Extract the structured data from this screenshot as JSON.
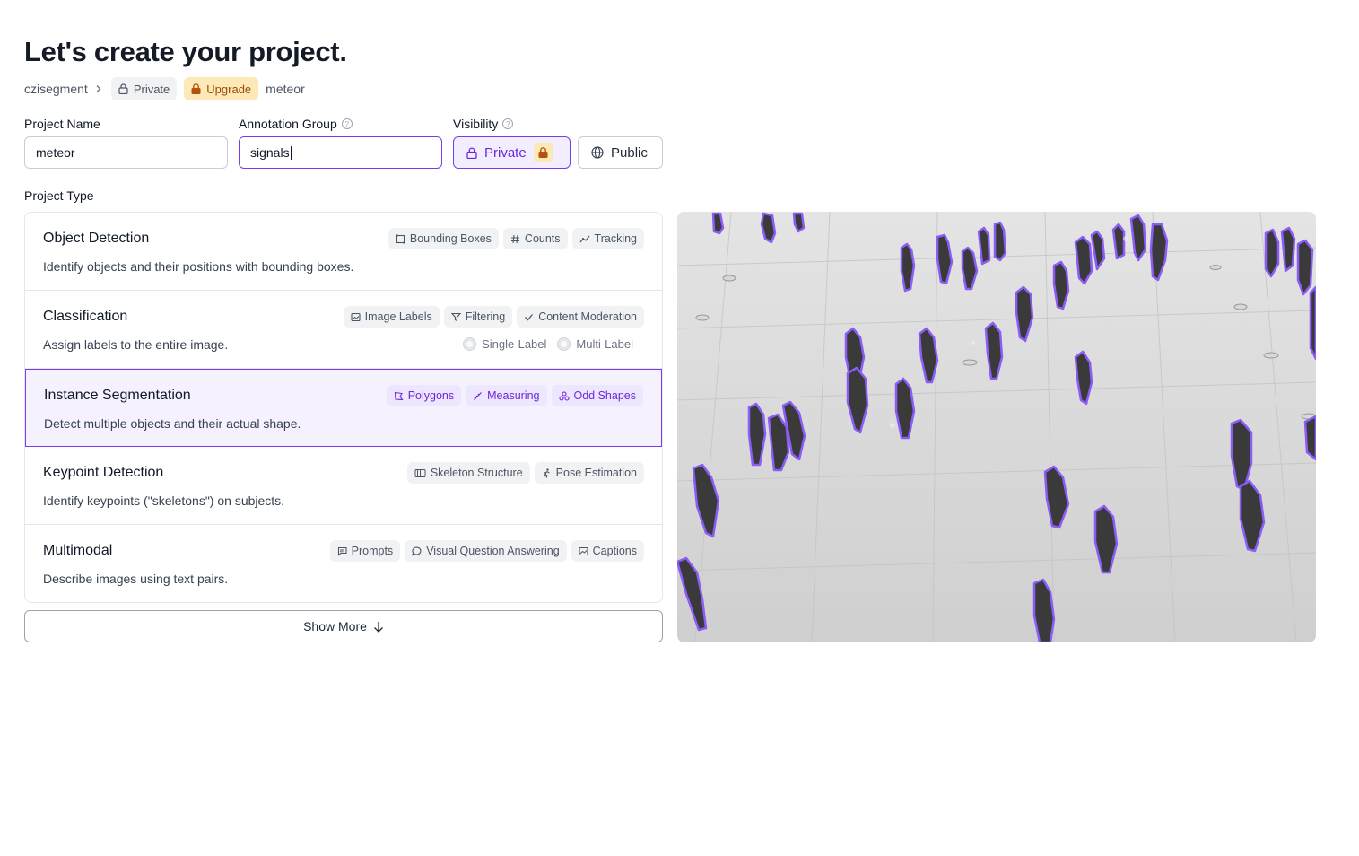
{
  "header": {
    "title": "Let's create your project."
  },
  "breadcrumb": {
    "workspace": "czisegment",
    "private_badge": "Private",
    "upgrade_badge": "Upgrade",
    "project": "meteor"
  },
  "form": {
    "project_name_label": "Project Name",
    "project_name_value": "meteor",
    "annotation_group_label": "Annotation Group",
    "annotation_group_value": "signals",
    "visibility_label": "Visibility",
    "visibility_private": "Private",
    "visibility_public": "Public",
    "visibility_selected": "Private"
  },
  "project_type": {
    "label": "Project Type",
    "selected": "Instance Segmentation",
    "types": [
      {
        "name": "Object Detection",
        "description": "Identify objects and their positions with bounding boxes.",
        "tags": [
          {
            "label": "Bounding Boxes",
            "icon": "bounding-box-icon"
          },
          {
            "label": "Counts",
            "icon": "hash-icon"
          },
          {
            "label": "Tracking",
            "icon": "tracking-icon"
          }
        ]
      },
      {
        "name": "Classification",
        "description": "Assign labels to the entire image.",
        "tags": [
          {
            "label": "Image Labels",
            "icon": "image-icon"
          },
          {
            "label": "Filtering",
            "icon": "filter-icon"
          },
          {
            "label": "Content Moderation",
            "icon": "check-icon"
          }
        ],
        "options": [
          "Single-Label",
          "Multi-Label"
        ]
      },
      {
        "name": "Instance Segmentation",
        "description": "Detect multiple objects and their actual shape.",
        "tags": [
          {
            "label": "Polygons",
            "icon": "polygon-icon"
          },
          {
            "label": "Measuring",
            "icon": "ruler-icon"
          },
          {
            "label": "Odd Shapes",
            "icon": "shapes-icon"
          }
        ]
      },
      {
        "name": "Keypoint Detection",
        "description": "Identify keypoints (\"skeletons\") on subjects.",
        "tags": [
          {
            "label": "Skeleton Structure",
            "icon": "skeleton-icon"
          },
          {
            "label": "Pose Estimation",
            "icon": "person-running-icon"
          }
        ]
      },
      {
        "name": "Multimodal",
        "description": "Describe images using text pairs.",
        "tags": [
          {
            "label": "Prompts",
            "icon": "prompt-icon"
          },
          {
            "label": "Visual Question Answering",
            "icon": "chat-bubble-icon"
          },
          {
            "label": "Captions",
            "icon": "image-icon"
          }
        ]
      }
    ],
    "show_more": "Show More"
  },
  "preview": {
    "icon": "segmentation-preview-image"
  },
  "colors": {
    "accent": "#7c3aed",
    "accent_bg": "#f5f1ff",
    "upgrade_bg": "#fde9b8",
    "upgrade_text": "#9a4a06",
    "outline": "#8b5cf6"
  }
}
